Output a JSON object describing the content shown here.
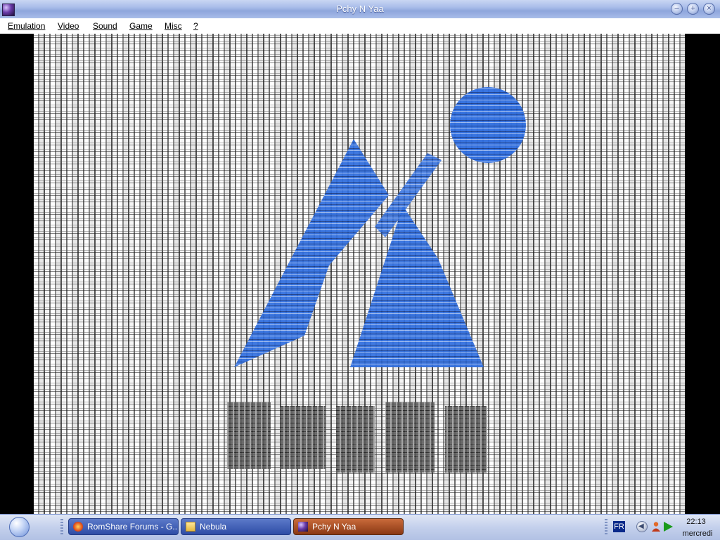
{
  "window": {
    "title": "Pchy N Yaa",
    "icon": "app-icon",
    "controls": [
      "minimize-icon",
      "maximize-icon",
      "close-icon"
    ]
  },
  "menu": {
    "items": [
      "Emulation",
      "Video",
      "Sound",
      "Game",
      "Misc",
      "?"
    ]
  },
  "game": {
    "screen": "emulator-display",
    "logo_colors": {
      "blue": "#2f6ee0",
      "dark": "#3a3a3a"
    }
  },
  "taskbar": {
    "tasks": [
      {
        "label": "RomShare Forums - G...",
        "icon": "browser-icon"
      },
      {
        "label": "Nebula",
        "icon": "folder-icon"
      },
      {
        "label": "Pchy N Yaa",
        "icon": "app-icon"
      }
    ],
    "language": "FR",
    "clock_time": "22:13",
    "clock_day": "mercredi"
  }
}
